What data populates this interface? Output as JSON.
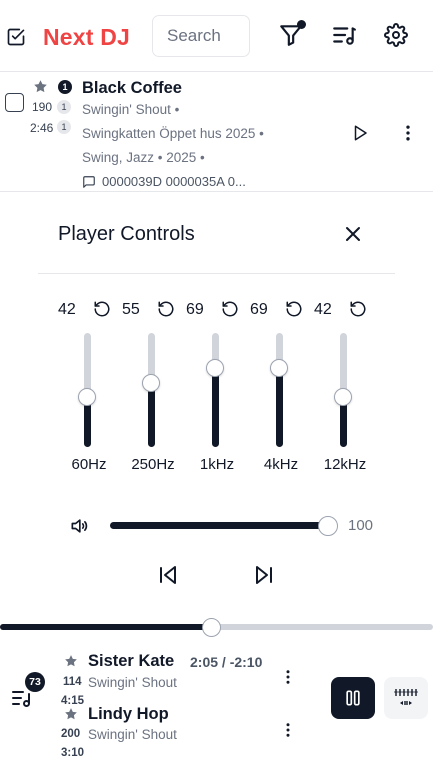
{
  "app": {
    "title": "Next DJ"
  },
  "search": {
    "placeholder": "Search"
  },
  "track": {
    "badge": "1",
    "bpm": "190",
    "bpm_count": "1",
    "duration": "2:46",
    "duration_count": "1",
    "title": "Black Coffee",
    "artist": "Swingin' Shout •",
    "album": "Swingkatten Öppet hus 2025 •",
    "genre_year": "Swing, Jazz • 2025 •",
    "comment": "0000039D 0000035A 0..."
  },
  "player_controls": {
    "title": "Player Controls",
    "eq": [
      {
        "label": "60Hz",
        "value": "42",
        "level": 0.44
      },
      {
        "label": "250Hz",
        "value": "55",
        "level": 0.56
      },
      {
        "label": "1kHz",
        "value": "69",
        "level": 0.69
      },
      {
        "label": "4kHz",
        "value": "69",
        "level": 0.69
      },
      {
        "label": "12kHz",
        "value": "42",
        "level": 0.44
      }
    ],
    "volume": {
      "value": "100",
      "level": 1.0
    }
  },
  "progress": {
    "level": 0.49
  },
  "queue": {
    "count": "73",
    "now_time": "2:05 / -2:10",
    "items": [
      {
        "title": "Sister Kate",
        "artist": "Swingin' Shout",
        "bpm": "114",
        "duration": "4:15"
      },
      {
        "title": "Lindy Hop",
        "artist": "Swingin' Shout",
        "bpm": "200",
        "duration": "3:10"
      }
    ]
  },
  "icons": {
    "select_all": "checkbox-checked-icon",
    "filter": "filter-icon",
    "queue": "playlist-icon",
    "settings": "gear-icon",
    "play": "play-icon",
    "more": "more-vertical-icon",
    "close": "close-icon",
    "reset": "rotate-ccw-icon",
    "volume": "volume-icon",
    "prev": "skip-back-icon",
    "next": "skip-forward-icon",
    "pause": "pause-icon",
    "waveform": "waveform-icon",
    "comment": "message-icon",
    "star": "star-icon"
  },
  "colors": {
    "brand": "#ef4444",
    "dark": "#111827",
    "muted": "#6b7280",
    "track_bg": "#d1d5db"
  }
}
